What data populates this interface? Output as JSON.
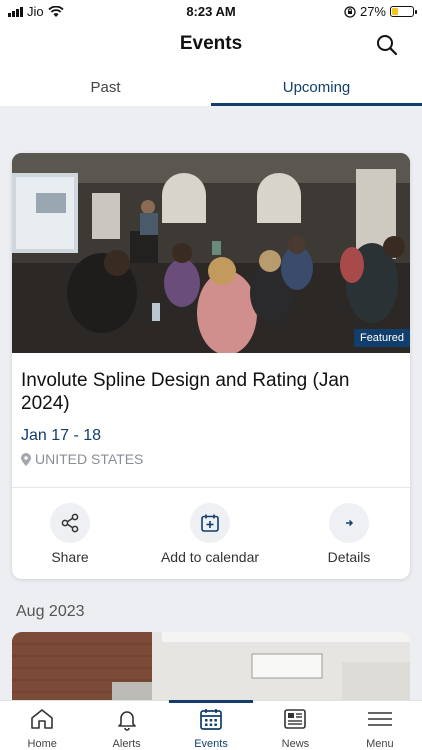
{
  "status": {
    "carrier": "Jio",
    "time": "8:23 AM",
    "battery": "27%"
  },
  "header": {
    "title": "Events"
  },
  "tabs": [
    {
      "label": "Past"
    },
    {
      "label": "Upcoming"
    }
  ],
  "event": {
    "badge": "Featured",
    "title": "Involute Spline Design and Rating (Jan 2024)",
    "date": "Jan  17 - 18",
    "location": "UNITED STATES",
    "actions": {
      "share": "Share",
      "calendar": "Add to calendar",
      "details": "Details"
    }
  },
  "section": {
    "title": "Aug 2023"
  },
  "nav": [
    {
      "label": "Home"
    },
    {
      "label": "Alerts"
    },
    {
      "label": "Events"
    },
    {
      "label": "News"
    },
    {
      "label": "Menu"
    }
  ],
  "colors": {
    "accent": "#123e6b",
    "background": "#eceef1"
  }
}
